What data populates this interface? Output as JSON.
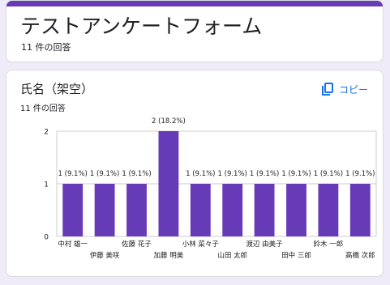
{
  "header": {
    "title": "テストアンケートフォーム",
    "response_count": "11 件の回答"
  },
  "question": {
    "title": "氏名（架空）",
    "response_count": "11 件の回答",
    "copy_label": "コピー"
  },
  "colors": {
    "accent": "#673ab7",
    "bar": "#673ab7",
    "link": "#1a73e8",
    "grid": "#cccccc"
  },
  "chart_data": {
    "type": "bar",
    "categories": [
      "中村 雄一",
      "伊藤 美咲",
      "佐藤 花子",
      "加藤 明美",
      "小林 菜々子",
      "山田 太郎",
      "渡辺 由美子",
      "田中 三郎",
      "鈴木 一郎",
      "高橋 次郎"
    ],
    "values": [
      1,
      1,
      1,
      2,
      1,
      1,
      1,
      1,
      1,
      1
    ],
    "data_labels": [
      "1 (9.1%)",
      "1 (9.1%)",
      "1 (9.1%)",
      "2 (18.2%)",
      "1 (9.1%)",
      "1 (9.1%)",
      "1 (9.1%)",
      "1 (9.1%)",
      "1 (9.1%)",
      "1 (9.1%)"
    ],
    "yticks": [
      0,
      1,
      2
    ],
    "ylim": [
      0,
      2
    ],
    "grid": true
  }
}
